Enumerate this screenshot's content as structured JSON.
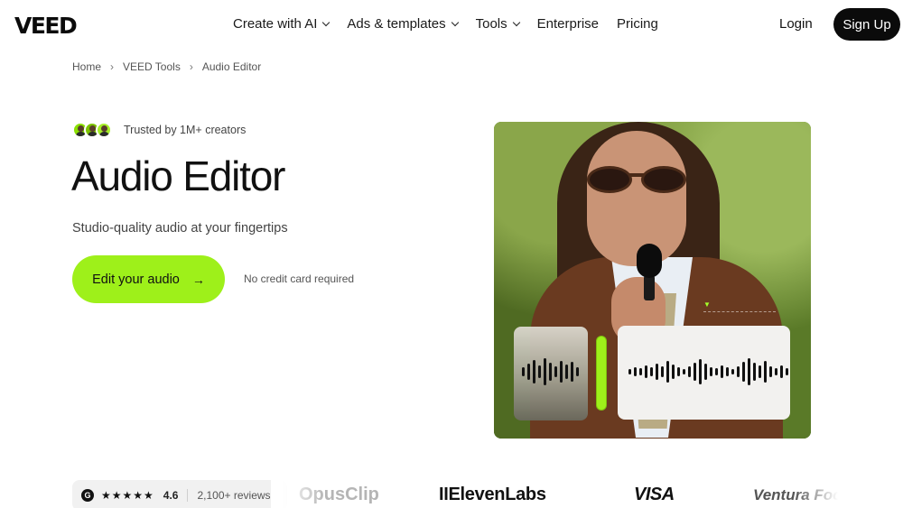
{
  "header": {
    "logo": "VEED",
    "nav": [
      {
        "label": "Create with AI",
        "has_dropdown": true
      },
      {
        "label": "Ads & templates",
        "has_dropdown": true
      },
      {
        "label": "Tools",
        "has_dropdown": true
      },
      {
        "label": "Enterprise",
        "has_dropdown": false
      },
      {
        "label": "Pricing",
        "has_dropdown": false
      }
    ],
    "login": "Login",
    "signup": "Sign Up"
  },
  "breadcrumb": [
    "Home",
    "VEED Tools",
    "Audio Editor"
  ],
  "hero": {
    "trusted_text": "Trusted by 1M+ creators",
    "title": "Audio Editor",
    "subtitle": "Studio-quality audio at your fingertips",
    "cta_label": "Edit your audio",
    "cta_arrow": "→",
    "no_credit": "No credit card required"
  },
  "reviews": {
    "badge_letter": "G",
    "stars": "★★★★★",
    "rating": "4.6",
    "count": "2,100+ reviews"
  },
  "brands": [
    "OpusClip",
    "IIElevenLabs",
    "VISA",
    "Ventura Foo"
  ],
  "colors": {
    "accent": "#9ef01a",
    "dark": "#0b0b0b"
  }
}
